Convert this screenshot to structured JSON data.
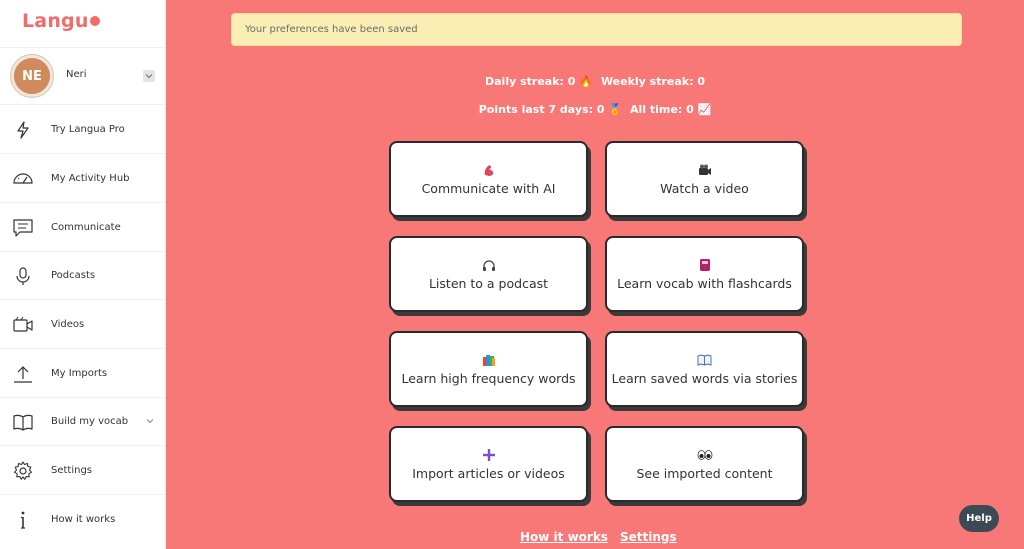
{
  "app": {
    "logo_text": "Langu"
  },
  "profile": {
    "initials": "NE",
    "name": "Neri"
  },
  "sidebar": {
    "items": [
      {
        "label": "Try Langua Pro",
        "icon": "lightning-icon"
      },
      {
        "label": "My Activity Hub",
        "icon": "gauge-icon"
      },
      {
        "label": "Communicate",
        "icon": "chat-icon"
      },
      {
        "label": "Podcasts",
        "icon": "microphone-icon"
      },
      {
        "label": "Videos",
        "icon": "video-camera-icon"
      },
      {
        "label": "My Imports",
        "icon": "upload-icon"
      },
      {
        "label": "Build my vocab",
        "icon": "book-icon"
      },
      {
        "label": "Settings",
        "icon": "gear-icon"
      },
      {
        "label": "How it works",
        "icon": "info-icon"
      }
    ]
  },
  "banner": {
    "text": "Your preferences have been saved"
  },
  "stats": {
    "daily": "Daily streak: 0 🔥",
    "weekly": "Weekly streak: 0",
    "points_week": "Points last 7 days: 0 🏅",
    "points_all": "All time: 0 📈"
  },
  "cards": [
    {
      "label": "Communicate with AI",
      "icon": "arm-icon"
    },
    {
      "label": "Watch a video",
      "icon": "camera-icon"
    },
    {
      "label": "Listen to a podcast",
      "icon": "headphones-icon"
    },
    {
      "label": "Learn vocab with flashcards",
      "icon": "flashcard-icon"
    },
    {
      "label": "Learn high frequency words",
      "icon": "books-icon"
    },
    {
      "label": "Learn saved words via stories",
      "icon": "open-book-icon"
    },
    {
      "label": "Import articles or videos",
      "icon": "plus-icon"
    },
    {
      "label": "See imported content",
      "icon": "eyes-icon"
    }
  ],
  "footer": {
    "how_it_works": "How it works",
    "settings": "Settings"
  },
  "help": {
    "label": "Help"
  },
  "colors": {
    "background": "#f87878",
    "accent": "#f26a6a",
    "banner": "#fbeeb4"
  }
}
